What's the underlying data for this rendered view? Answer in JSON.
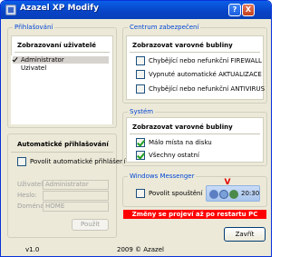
{
  "window": {
    "title": "Azazel XP Modify",
    "help_button": "?",
    "close_button": "X"
  },
  "prihlasovani": {
    "group_title": "Přihlašování",
    "users_heading": "Zobrazovaní uživatelé",
    "users": [
      {
        "name": "Administrator",
        "checked": true,
        "selected": true
      },
      {
        "name": "Uzivatel",
        "checked": false,
        "selected": false
      }
    ]
  },
  "autologin": {
    "heading": "Automatické přihlašování",
    "enable_label": "Povolit automatické přihlášení",
    "enable_checked": false,
    "user_label": "Uživatel:",
    "user_value": "Administrator",
    "password_label": "Heslo:",
    "password_value": "",
    "domain_label": "Doména:",
    "domain_value": "HOME",
    "apply_button": "Použít"
  },
  "security_center": {
    "group_title": "Centrum zabezpečení",
    "heading": "Zobrazovat varovné bubliny",
    "options": [
      {
        "label": "Chybějící nebo nefunkční FIREWALL",
        "checked": false
      },
      {
        "label": "Vypnuté automatické AKTUALIZACE",
        "checked": false
      },
      {
        "label": "Chybějící nebo nefunkční ANTIVIRUS",
        "checked": false
      }
    ]
  },
  "system": {
    "group_title": "Systém",
    "heading": "Zobrazovat varovné bubliny",
    "options": [
      {
        "label": "Málo místa na disku",
        "checked": true
      },
      {
        "label": "Všechny ostatní",
        "checked": true
      }
    ]
  },
  "messenger": {
    "group_title": "Windows Messenger",
    "enable_label": "Povolit spouštění",
    "enable_checked": false,
    "tray_arrow": "V",
    "tray_time": "20:30"
  },
  "banner": {
    "text": "Změny se projeví až po restartu PC",
    "color": "#ff0000"
  },
  "footer": {
    "version": "v1.0",
    "copyright": "2009 © Azazel",
    "close_button": "Zavřít"
  },
  "colors": {
    "titlebar": "#0843c6",
    "group_title": "#0046d5",
    "checkbox_mark": "#21a121"
  }
}
